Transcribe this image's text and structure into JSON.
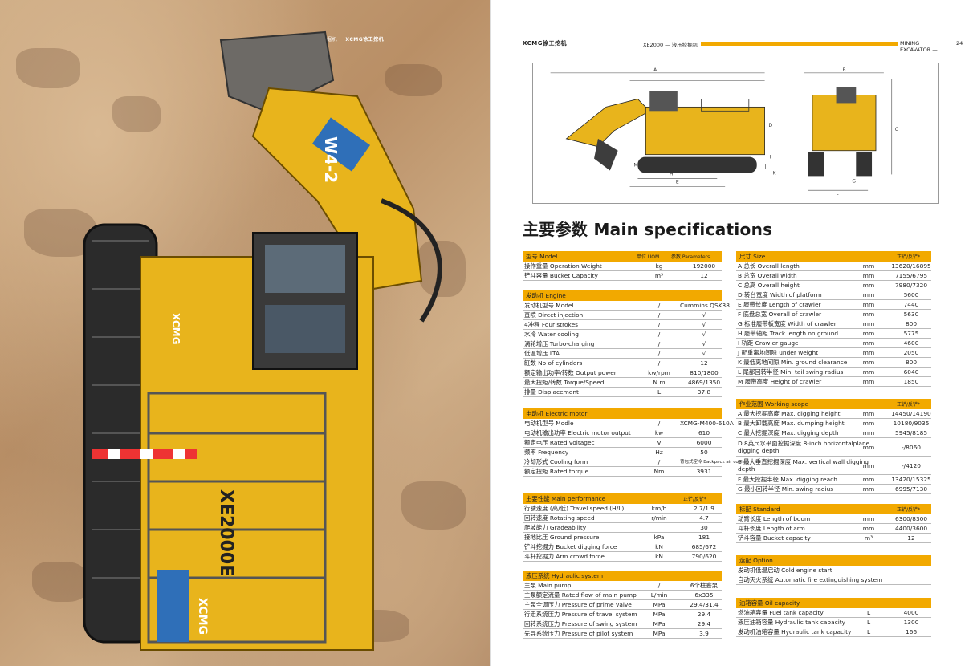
{
  "photo": {
    "header_model": "XE2000 — 液压挖掘机",
    "header_brand": "XCMG徐工挖机",
    "boom_decal": "W4-2",
    "side_model": "XE2000E",
    "cab_brand": "XCMG"
  },
  "header": {
    "logo": "XCMG徐工挖机",
    "model": "XE2000 — 液压挖掘机",
    "category": "MINING EXCAVATOR —",
    "page": "24"
  },
  "drawing_labels": {
    "side": [
      "A",
      "L",
      "D",
      "E",
      "H",
      "I",
      "J",
      "K",
      "M"
    ],
    "front": [
      "B",
      "F",
      "C",
      "G"
    ]
  },
  "title": "主要参数 Main specifications",
  "left_sections": [
    {
      "title": "型号 Model",
      "col_unit": "单位 UOM",
      "col_value": "参数 Parameters",
      "rows": [
        {
          "name": "操作重量 Operation Weight",
          "unit": "kg",
          "value": "192000"
        },
        {
          "name": "铲斗容量 Bucket Capacity",
          "unit": "m³",
          "value": "12"
        }
      ]
    },
    {
      "title": "发动机 Engine",
      "rows": [
        {
          "name": "发动机型号 Model",
          "unit": "/",
          "value": "Cummins QSK38"
        },
        {
          "name": "直喷 Direct injection",
          "unit": "/",
          "value": "√"
        },
        {
          "name": "4冲程 Four strokes",
          "unit": "/",
          "value": "√"
        },
        {
          "name": "水冷 Water cooling",
          "unit": "/",
          "value": "√"
        },
        {
          "name": "涡轮增压 Turbo-charging",
          "unit": "/",
          "value": "√"
        },
        {
          "name": "低温增压 LTA",
          "unit": "/",
          "value": "√"
        },
        {
          "name": "缸数 No of cylinders",
          "unit": "/",
          "value": "12"
        },
        {
          "name": "额定输出功率/转数 Output power",
          "unit": "kw/rpm",
          "value": "810/1800"
        },
        {
          "name": "最大扭矩/转数 Torque/Speed",
          "unit": "N.m",
          "value": "4869/1350"
        },
        {
          "name": "排量 Displacement",
          "unit": "L",
          "value": "37.8"
        }
      ]
    },
    {
      "title": "电动机 Electric motor",
      "rows": [
        {
          "name": "电动机型号 Modle",
          "unit": "/",
          "value": "XCMG-M400-610A"
        },
        {
          "name": "电动机输出功率 Electric motor output",
          "unit": "kw",
          "value": "610"
        },
        {
          "name": "额定电压 Rated voltagec",
          "unit": "V",
          "value": "6000"
        },
        {
          "name": "频率 Frequency",
          "unit": "Hz",
          "value": "50"
        },
        {
          "name": "冷却形式 Cooling form",
          "unit": "/",
          "value": "背包式空冷 Backpack air cooling",
          "small": true
        },
        {
          "name": "额定扭矩 Rated torque",
          "unit": "Nm",
          "value": "3931"
        }
      ]
    },
    {
      "title": "主要性能 Main performance",
      "col_value": "正铲/反铲*",
      "rows": [
        {
          "name": "行驶速度 (高/低) Travel speed (H/L)",
          "unit": "km/h",
          "value": "2.7/1.9"
        },
        {
          "name": "回转速度 Rotating speed",
          "unit": "r/min",
          "value": "4.7"
        },
        {
          "name": "爬坡能力 Gradeability",
          "unit": "",
          "value": "30"
        },
        {
          "name": "接地比压 Ground pressure",
          "unit": "kPa",
          "value": "181"
        },
        {
          "name": "铲斗挖掘力 Bucket digging force",
          "unit": "kN",
          "value": "685/672"
        },
        {
          "name": "斗杆挖掘力 Arm crowd force",
          "unit": "kN",
          "value": "790/620"
        }
      ]
    },
    {
      "title": "液压系统 Hydraulic system",
      "rows": [
        {
          "name": "主泵 Main pump",
          "unit": "/",
          "value": "6个柱塞泵"
        },
        {
          "name": "主泵额定流量 Rated flow of main pump",
          "unit": "L/min",
          "value": "6x335"
        },
        {
          "name": "主泵全调压力 Pressure of prime valve",
          "unit": "MPa",
          "value": "29.4/31.4"
        },
        {
          "name": "行走系统压力 Pressure of travel system",
          "unit": "MPa",
          "value": "29.4"
        },
        {
          "name": "回转系统压力 Pressure of swing system",
          "unit": "MPa",
          "value": "29.4"
        },
        {
          "name": "先导系统压力 Pressure of pilot system",
          "unit": "MPa",
          "value": "3.9"
        }
      ]
    }
  ],
  "right_sections": [
    {
      "title": "尺寸 Size",
      "col_value": "正铲/反铲*",
      "rows": [
        {
          "name": "A 总长 Overall length",
          "unit": "mm",
          "value": "13620/16895"
        },
        {
          "name": "B 总宽 Overall width",
          "unit": "mm",
          "value": "7155/6795"
        },
        {
          "name": "C 总高 Overall height",
          "unit": "mm",
          "value": "7980/7320"
        },
        {
          "name": "D 转台宽度 Width of platform",
          "unit": "mm",
          "value": "5600"
        },
        {
          "name": "E 履带长度 Length of crawler",
          "unit": "mm",
          "value": "7440"
        },
        {
          "name": "F 底盘总宽 Overall of crawler",
          "unit": "mm",
          "value": "5630"
        },
        {
          "name": "G 标准履带板宽度 Width of crawler",
          "unit": "mm",
          "value": "800"
        },
        {
          "name": "H 履带轴距 Track length on ground",
          "unit": "mm",
          "value": "5775"
        },
        {
          "name": "I 轨距 Crawler gauge",
          "unit": "mm",
          "value": "4600"
        },
        {
          "name": "J 配重离地间隙 under weight",
          "unit": "mm",
          "value": "2050"
        },
        {
          "name": "K 最低离地间隙 Min. ground clearance",
          "unit": "mm",
          "value": "800"
        },
        {
          "name": "L 尾部回转半径 Min. tail swing radius",
          "unit": "mm",
          "value": "6040"
        },
        {
          "name": "M 履带高度 Height of crawler",
          "unit": "mm",
          "value": "1850"
        }
      ]
    },
    {
      "title": "作业范围 Working scope",
      "col_value": "正铲/反铲*",
      "rows": [
        {
          "name": "A 最大挖掘高度 Max. digging height",
          "unit": "mm",
          "value": "14450/14190"
        },
        {
          "name": "B 最大卸载高度 Max. dumping height",
          "unit": "mm",
          "value": "10180/9035"
        },
        {
          "name": "C 最大挖掘深度 Max. digging depth",
          "unit": "mm",
          "value": "5945/8185"
        },
        {
          "name": "D 8英尺水平面挖掘深度 8-inch horizontalplane digging depth",
          "unit": "mm",
          "value": "-/8060",
          "tall": true
        },
        {
          "name": "E 最大垂直挖掘深度 Max. vertical wall digging depth",
          "unit": "mm",
          "value": "-/4120",
          "tall": true
        },
        {
          "name": "F 最大挖掘半径 Max. digging reach",
          "unit": "mm",
          "value": "13420/15325"
        },
        {
          "name": "G 最小回转半径 Min. swing radius",
          "unit": "mm",
          "value": "6995/7130"
        }
      ]
    },
    {
      "title": "标配 Standard",
      "col_value": "正铲/反铲*",
      "rows": [
        {
          "name": "动臂长度 Length of boom",
          "unit": "mm",
          "value": "6300/8300"
        },
        {
          "name": "斗杆长度 Length of arm",
          "unit": "mm",
          "value": "4400/3600"
        },
        {
          "name": "铲斗容量 Bucket capacity",
          "unit": "m³",
          "value": "12"
        }
      ]
    },
    {
      "title": "选配 Option",
      "rows": [
        {
          "name": "发动机低温启动 Cold engine start",
          "unit": "",
          "value": ""
        },
        {
          "name": "自动灭火系统 Automatic fire extinguishing system",
          "unit": "",
          "value": ""
        }
      ]
    },
    {
      "title": "油箱容量 Oil capacity",
      "rows": [
        {
          "name": "燃油箱容量 Fuel tank capacity",
          "unit": "L",
          "value": "4000"
        },
        {
          "name": "液压油箱容量 Hydraulic tank capacity",
          "unit": "L",
          "value": "1300"
        },
        {
          "name": "发动机油箱容量 Hydraulic tank capacity",
          "unit": "L",
          "value": "166"
        }
      ]
    }
  ],
  "colors": {
    "accent": "#f2a900",
    "machine_yellow": "#e8b41c",
    "text": "#222222"
  }
}
